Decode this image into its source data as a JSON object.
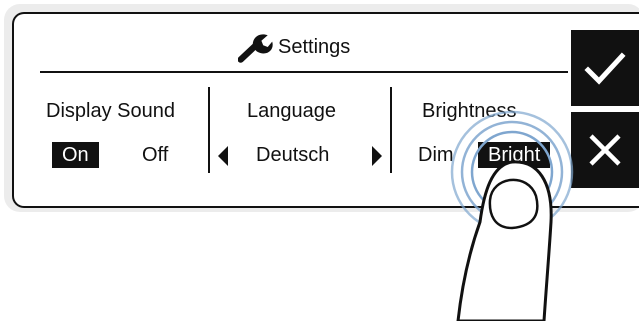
{
  "header": {
    "title": "Settings",
    "icon": "wrench-icon"
  },
  "display_sound": {
    "label": "Display Sound",
    "options": [
      "On",
      "Off"
    ],
    "selected": "On"
  },
  "language": {
    "label": "Language",
    "value": "Deutsch",
    "prev_icon": "triangle-left-icon",
    "next_icon": "triangle-right-icon"
  },
  "brightness": {
    "label": "Brightness",
    "options": [
      "Dim",
      "Bright"
    ],
    "selected": "Bright"
  },
  "actions": {
    "confirm_icon": "checkmark-icon",
    "cancel_icon": "close-icon"
  },
  "colors": {
    "foreground": "#111111",
    "background": "#ffffff",
    "touch_ring": "#7fa6cf"
  }
}
